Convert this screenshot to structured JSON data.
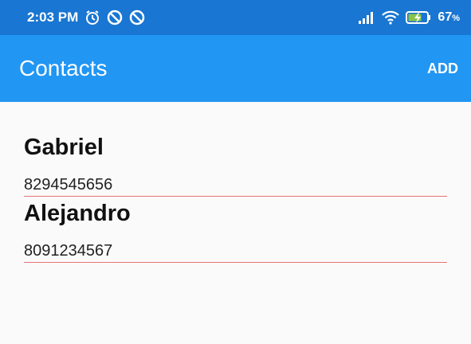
{
  "status_bar": {
    "time": "2:03 PM",
    "left_icons": [
      "alarm-icon",
      "do-not-disturb-icon",
      "do-not-disturb-icon"
    ],
    "right_icons": [
      "signal-icon",
      "wifi-icon",
      "battery-charging-icon"
    ],
    "battery_percent": "67"
  },
  "app_bar": {
    "title": "Contacts",
    "add_label": "ADD",
    "color": "#2196f3"
  },
  "contacts": [
    {
      "name": "Gabriel",
      "phone": "8294545656"
    },
    {
      "name": "Alejandro",
      "phone": "8091234567"
    }
  ],
  "colors": {
    "status_bar": "#1976d2",
    "divider": "#e57373"
  }
}
